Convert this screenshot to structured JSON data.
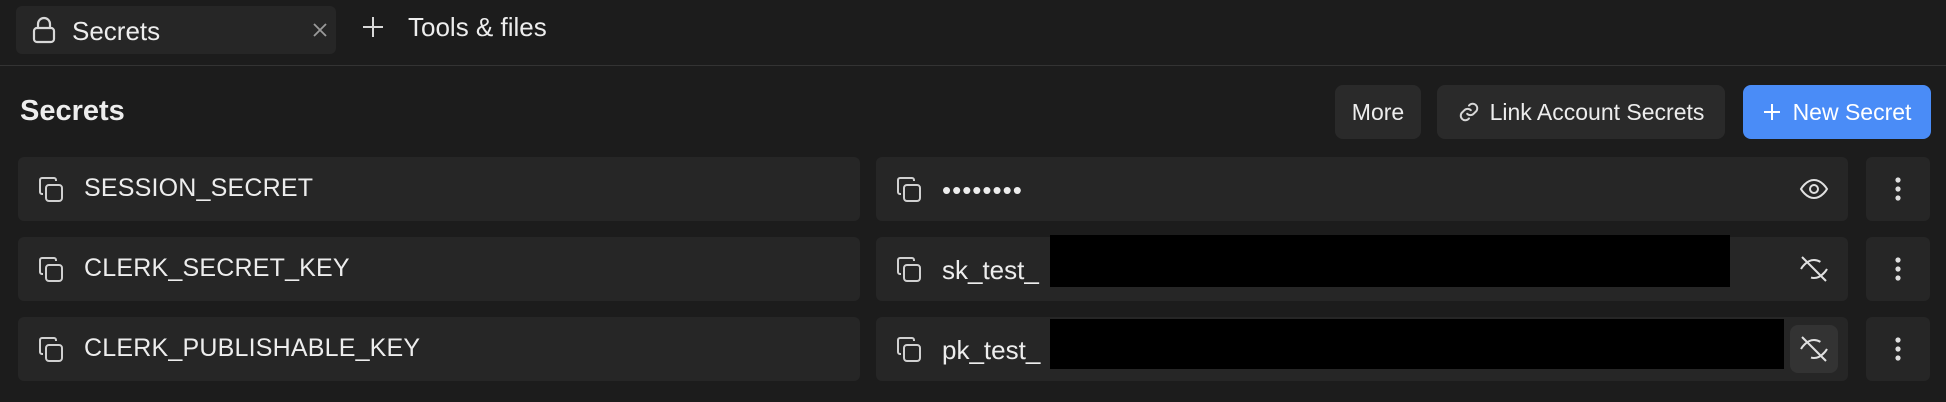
{
  "tabs": {
    "active_label": "Secrets",
    "active_icon": "lock-icon",
    "close_icon": "close-icon",
    "add_label": "Tools & files",
    "add_icon": "plus-icon"
  },
  "header": {
    "title": "Secrets",
    "more_label": "More",
    "link_label": "Link Account Secrets",
    "link_icon": "link-icon",
    "new_label": "New Secret",
    "accent_color": "#4a8cf7"
  },
  "secrets": [
    {
      "key": "SESSION_SECRET",
      "value": "••••••••",
      "visible": false,
      "eye_icon": "eye-icon"
    },
    {
      "key": "CLERK_SECRET_KEY",
      "value": "sk_test_",
      "visible": true,
      "eye_icon": "eye-off-icon",
      "redacted": true
    },
    {
      "key": "CLERK_PUBLISHABLE_KEY",
      "value": "pk_test_",
      "visible": true,
      "eye_icon": "eye-off-icon",
      "redacted": true
    }
  ]
}
